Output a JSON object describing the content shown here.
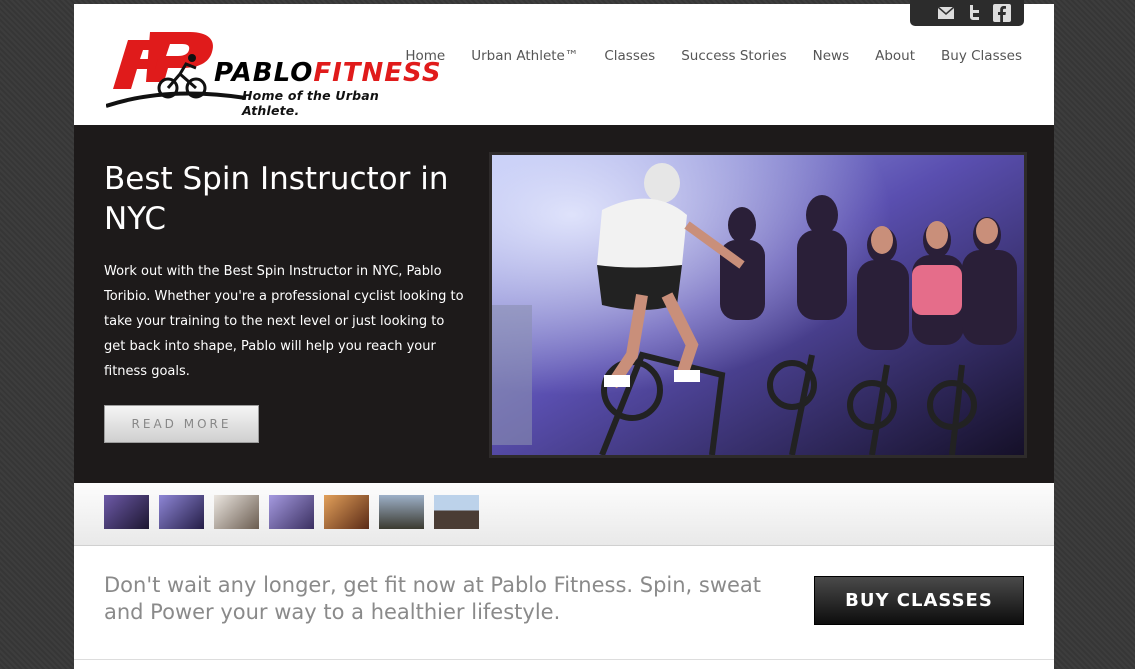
{
  "social": {
    "icons": [
      "mail-icon",
      "twitter-icon",
      "facebook-icon"
    ]
  },
  "header": {
    "logo": {
      "brand_pablo": "PABLO",
      "brand_fitness": "FITNESS",
      "tagline": "Home of the Urban Athlete."
    },
    "nav": [
      "Home",
      "Urban Athlete™",
      "Classes",
      "Success Stories",
      "News",
      "About",
      "Buy Classes"
    ]
  },
  "hero": {
    "title": "Best Spin Instructor in NYC",
    "body": "Work out with the Best Spin Instructor in NYC, Pablo Toribio. Whether you're a professional cyclist looking to take your training to the next level or just looking to get back into shape, Pablo will help you reach your fitness goals.",
    "button": "READ MORE"
  },
  "thumbnails": [
    "spin-class",
    "spin-class-2",
    "group-portrait",
    "indoor-class",
    "fitness-ball",
    "outdoor-group",
    "beach-group"
  ],
  "cta": {
    "text": "Don't wait any longer, get fit now at Pablo Fitness. Spin, sweat and Power your way to a healthier lifestyle.",
    "button": "BUY CLASSES"
  },
  "colors": {
    "accent": "#e01b1b",
    "hero_bg": "#1d1a1a",
    "nav_text": "#555555"
  }
}
